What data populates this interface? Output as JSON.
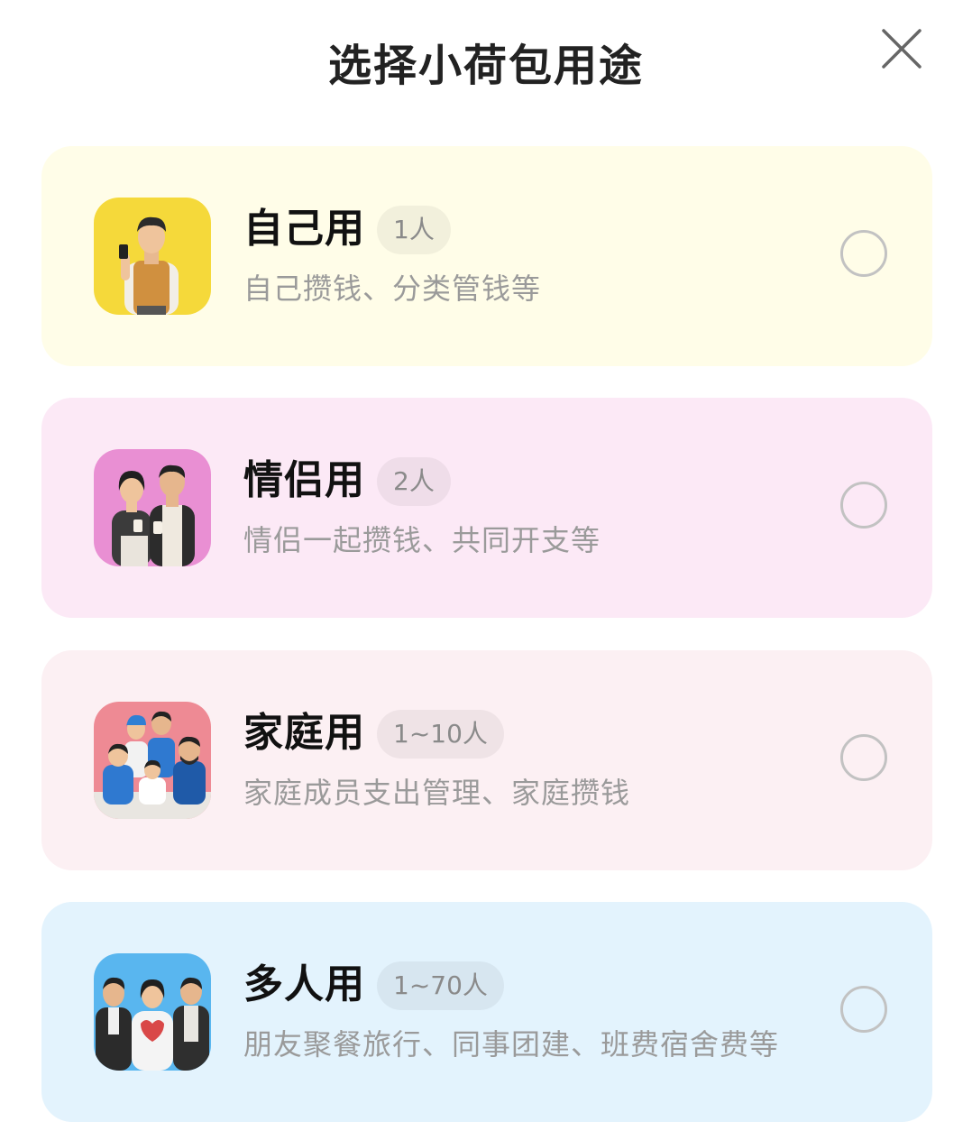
{
  "header": {
    "title": "选择小荷包用途",
    "close_icon": "close-icon"
  },
  "options": [
    {
      "name": "自己用",
      "badge": "1人",
      "desc": "自己攒钱、分类管钱等",
      "card_color": "#fffde8",
      "avatar_bg": "#f5d93a",
      "icon": "single-person-avatar-icon",
      "selected": false
    },
    {
      "name": "情侣用",
      "badge": "2人",
      "desc": "情侣一起攒钱、共同开支等",
      "card_color": "#fce9f6",
      "avatar_bg": "#e98fd3",
      "icon": "couple-avatar-icon",
      "selected": false
    },
    {
      "name": "家庭用",
      "badge": "1~10人",
      "desc": "家庭成员支出管理、家庭攒钱",
      "card_color": "#fcf0f3",
      "avatar_bg": "#ee8a94",
      "icon": "family-avatar-icon",
      "selected": false
    },
    {
      "name": "多人用",
      "badge": "1~70人",
      "desc": "朋友聚餐旅行、同事团建、班费宿舍费等",
      "card_color": "#e3f3fd",
      "avatar_bg": "#59b6ef",
      "icon": "group-avatar-icon",
      "selected": false
    }
  ]
}
